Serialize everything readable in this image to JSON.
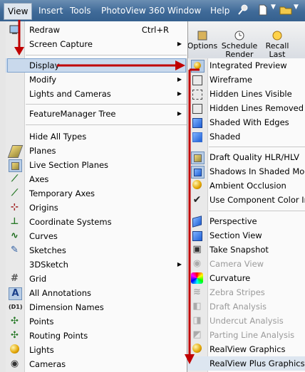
{
  "menubar": {
    "items": [
      "View",
      "Insert",
      "Tools",
      "PhotoView 360",
      "Window",
      "Help"
    ],
    "active": "View"
  },
  "toolbar_bg": {
    "buttons": [
      "Options",
      "Schedule Render",
      "Recall Last"
    ]
  },
  "view_menu": {
    "items": [
      {
        "label": "Redraw",
        "shortcut": "Ctrl+R",
        "icon": "redraw-icon"
      },
      {
        "label": "Screen Capture",
        "submenu": true,
        "icon": ""
      },
      {
        "label": "Display",
        "submenu": true,
        "highlighted": true
      },
      {
        "label": "Modify",
        "submenu": true
      },
      {
        "label": "Lights and Cameras",
        "submenu": true
      },
      {
        "label": "FeatureManager Tree",
        "submenu": true
      },
      {
        "label": "Hide All Types"
      },
      {
        "label": "Planes",
        "icon": "planes-icon"
      },
      {
        "label": "Live Section Planes",
        "icon": "live-section-icon",
        "checked": true
      },
      {
        "label": "Axes",
        "icon": "axes-icon"
      },
      {
        "label": "Temporary Axes",
        "icon": "temp-axes-icon"
      },
      {
        "label": "Origins",
        "icon": "origins-icon"
      },
      {
        "label": "Coordinate Systems",
        "icon": "coordinate-systems-icon"
      },
      {
        "label": "Curves",
        "icon": "curves-icon"
      },
      {
        "label": "Sketches",
        "icon": "sketches-icon"
      },
      {
        "label": "3DSketch",
        "submenu": true
      },
      {
        "label": "Grid",
        "icon": "grid-icon"
      },
      {
        "label": "All Annotations",
        "icon": "annotations-icon",
        "checked": true
      },
      {
        "label": "Dimension Names",
        "icon": "dimension-names-icon"
      },
      {
        "label": "Points",
        "icon": "points-icon"
      },
      {
        "label": "Routing Points",
        "icon": "routing-points-icon"
      },
      {
        "label": "Lights",
        "icon": "lights-icon"
      },
      {
        "label": "Cameras",
        "icon": "cameras-icon"
      }
    ]
  },
  "display_submenu": {
    "items": [
      {
        "label": "Integrated Preview",
        "icon": "integrated-preview-icon"
      },
      {
        "label": "Wireframe",
        "icon": "wireframe-icon"
      },
      {
        "label": "Hidden Lines Visible",
        "icon": "hidden-lines-visible-icon"
      },
      {
        "label": "Hidden Lines Removed",
        "icon": "hidden-lines-removed-icon"
      },
      {
        "label": "Shaded With Edges",
        "icon": "shaded-edges-icon"
      },
      {
        "label": "Shaded",
        "icon": "shaded-icon"
      },
      {
        "label": "Draft Quality HLR/HLV",
        "icon": "draft-quality-icon"
      },
      {
        "label": "Shadows In Shaded Mode",
        "icon": "shadows-icon"
      },
      {
        "label": "Ambient Occlusion",
        "icon": "ambient-occlusion-icon"
      },
      {
        "label": "Use Component Color In",
        "icon": "check-icon"
      },
      {
        "label": "Perspective",
        "icon": "perspective-icon"
      },
      {
        "label": "Section View",
        "icon": "section-view-icon"
      },
      {
        "label": "Take Snapshot",
        "icon": "snapshot-icon"
      },
      {
        "label": "Camera View",
        "icon": "camera-view-icon",
        "disabled": true
      },
      {
        "label": "Curvature",
        "icon": "curvature-icon"
      },
      {
        "label": "Zebra Stripes",
        "icon": "zebra-icon",
        "disabled": true
      },
      {
        "label": "Draft Analysis",
        "icon": "draft-analysis-icon",
        "disabled": true
      },
      {
        "label": "Undercut Analysis",
        "icon": "undercut-icon",
        "disabled": true
      },
      {
        "label": "Parting Line Analysis",
        "icon": "parting-line-icon",
        "disabled": true
      },
      {
        "label": "RealView Graphics",
        "icon": "realview-icon"
      },
      {
        "label": "RealView Plus Graphics",
        "icon": ""
      }
    ]
  },
  "colors": {
    "menubar": "#3f6a98",
    "highlight": "#c9d9ec",
    "arrow": "#c00000"
  }
}
